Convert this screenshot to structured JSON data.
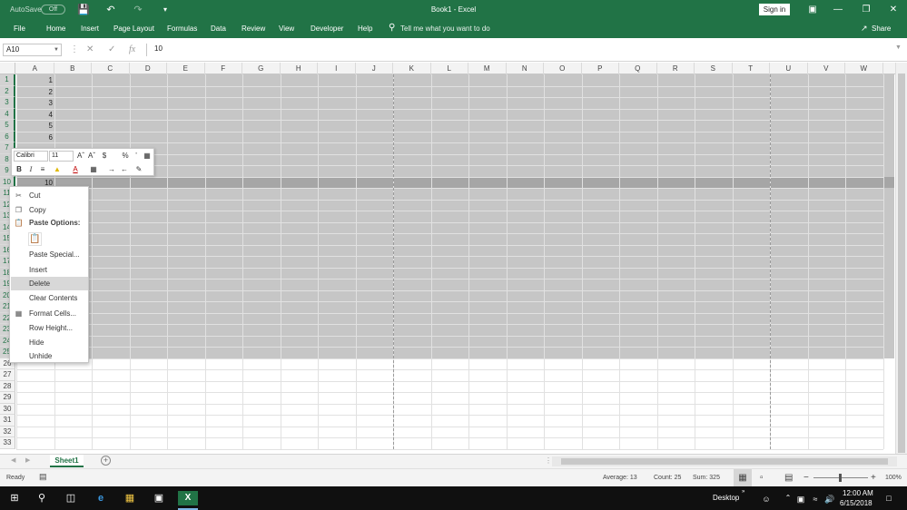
{
  "titlebar": {
    "autosave_label": "AutoSave",
    "autosave_state": "Off",
    "doc_title": "Book1 - Excel",
    "signin": "Sign in"
  },
  "ribbon": {
    "tabs": [
      "File",
      "Home",
      "Insert",
      "Page Layout",
      "Formulas",
      "Data",
      "Review",
      "View",
      "Developer",
      "Help"
    ],
    "tellme": "Tell me what you want to do",
    "share": "Share"
  },
  "formula_bar": {
    "namebox": "A10",
    "fx": "fx",
    "value": "10"
  },
  "grid": {
    "columns": [
      "A",
      "B",
      "C",
      "D",
      "E",
      "F",
      "G",
      "H",
      "I",
      "J",
      "K",
      "L",
      "M",
      "N",
      "O",
      "P",
      "Q",
      "R",
      "S",
      "T",
      "U",
      "V",
      "W"
    ],
    "rows": [
      "1",
      "2",
      "3",
      "4",
      "5",
      "6",
      "7",
      "8",
      "9",
      "10",
      "11",
      "12",
      "13",
      "14",
      "15",
      "16",
      "17",
      "18",
      "19",
      "20",
      "21",
      "22",
      "23",
      "24",
      "25",
      "26",
      "27",
      "28",
      "29",
      "30",
      "31",
      "32",
      "33"
    ],
    "visible_values": [
      "1",
      "2",
      "3",
      "4",
      "5",
      "6",
      "10"
    ]
  },
  "mini_toolbar": {
    "font": "Calibri",
    "size": "11"
  },
  "context_menu": {
    "items": [
      "Cut",
      "Copy",
      "Paste Options:",
      "Paste Special...",
      "Insert",
      "Delete",
      "Clear Contents",
      "Format Cells...",
      "Row Height...",
      "Hide",
      "Unhide"
    ]
  },
  "sheets": {
    "tabs": [
      "Sheet1"
    ]
  },
  "status": {
    "ready": "Ready",
    "average": "Average: 13",
    "count": "Count: 25",
    "sum": "Sum: 325",
    "zoom": "100%"
  },
  "taskbar": {
    "desktop": "Desktop",
    "time": "12:00 AM",
    "date": "6/15/2018"
  }
}
